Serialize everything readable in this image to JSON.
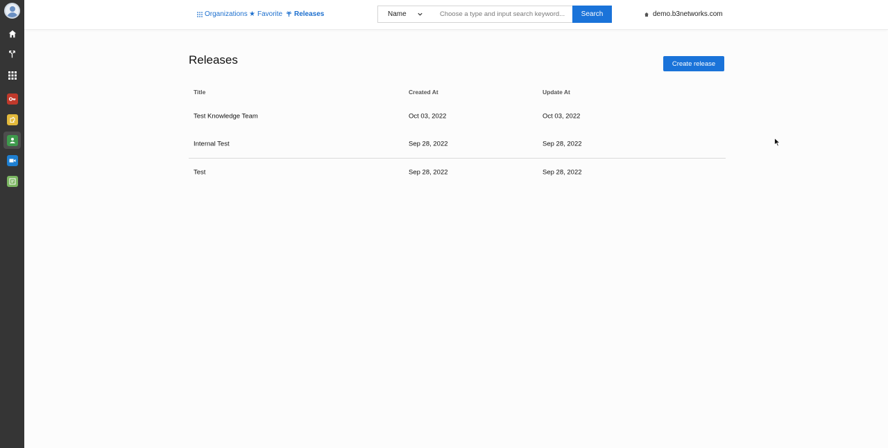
{
  "nav": {
    "organizations": "Organizations",
    "favorite": "Favorite",
    "releases": "Releases"
  },
  "search": {
    "type_selected": "Name",
    "placeholder": "Choose a type and input search keyword...",
    "button_label": "Search"
  },
  "domain": "demo.b3networks.com",
  "page": {
    "title": "Releases",
    "create_button": "Create release"
  },
  "table": {
    "columns": [
      "Title",
      "Created At",
      "Update At"
    ],
    "rows": [
      {
        "title": "Test Knowledge Team",
        "created_at": "Oct 03, 2022",
        "updated_at": "Oct 03, 2022"
      },
      {
        "title": "Internal Test",
        "created_at": "Sep 28, 2022",
        "updated_at": "Sep 28, 2022"
      },
      {
        "title": "Test",
        "created_at": "Sep 28, 2022",
        "updated_at": "Sep 28, 2022"
      }
    ]
  },
  "rail": {
    "items": [
      "home-icon",
      "branch-icon",
      "apps-grid-icon",
      "key-app-icon",
      "puzzle-app-icon",
      "support-app-icon",
      "video-app-icon",
      "notes-app-icon"
    ]
  },
  "colors": {
    "accent": "#1a73d9",
    "rail_bg": "#353535",
    "app_red": "#c0392b",
    "app_yellow": "#e2b93b",
    "app_green": "#3e9a4c",
    "app_blue": "#1e7fd1",
    "app_lime": "#7bb661"
  }
}
